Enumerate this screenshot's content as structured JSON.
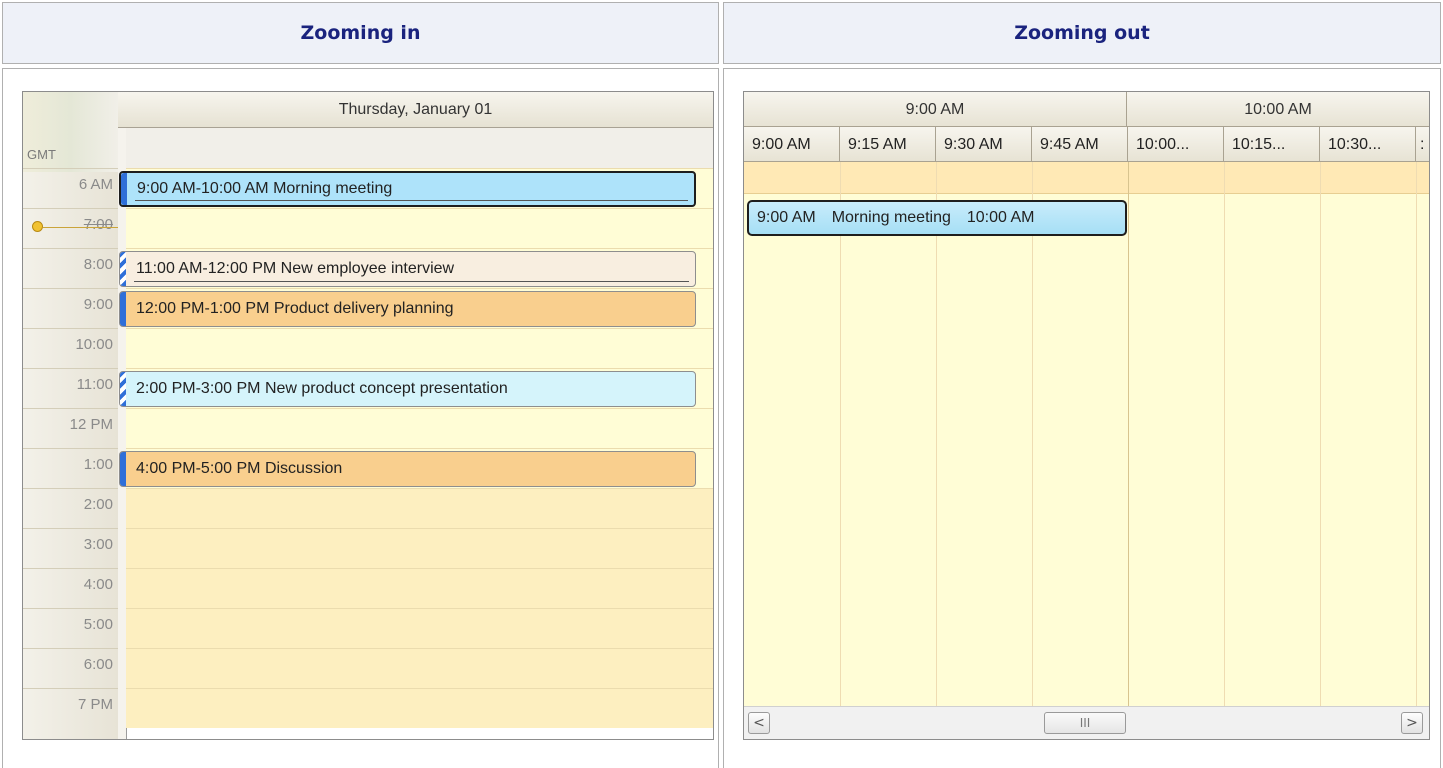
{
  "columns": [
    {
      "title": "Zooming in"
    },
    {
      "title": "Zooming out"
    }
  ],
  "day_view": {
    "date_header": "Thursday, January 01",
    "timezone_label": "GMT",
    "time_labels": [
      "6 AM",
      "7:00",
      "8:00",
      "9:00",
      "10:00",
      "11:00",
      "12 PM",
      "1:00",
      "2:00",
      "3:00",
      "4:00",
      "5:00",
      "6:00",
      "7 PM"
    ],
    "appointments": [
      {
        "text": "9:00 AM-10:00 AM Morning meeting",
        "selected": true,
        "status_color": "#2f6fd8",
        "bg": "#aee3fa",
        "status_pattern": "solid"
      },
      {
        "text": "11:00 AM-12:00 PM New employee interview",
        "selected": false,
        "status_color": "#2f6fd8",
        "bg": "#f8eee0",
        "status_pattern": "tentative"
      },
      {
        "text": "12:00 PM-1:00 PM Product delivery planning",
        "selected": false,
        "status_color": "#2f6fd8",
        "bg": "#f9cf8e",
        "status_pattern": "solid"
      },
      {
        "text": "2:00 PM-3:00 PM New product concept presentation",
        "selected": false,
        "status_color": "#2f6fd8",
        "bg": "#d5f4fb",
        "status_pattern": "tentative"
      },
      {
        "text": "4:00 PM-5:00 PM Discussion",
        "selected": false,
        "status_color": "#2f6fd8",
        "bg": "#f9cf8e",
        "status_pattern": "solid"
      }
    ]
  },
  "timeline_view": {
    "hour_headers": [
      "9:00 AM",
      "10:00 AM"
    ],
    "slot_headers": [
      "9:00 AM",
      "9:15 AM",
      "9:30 AM",
      "9:45 AM",
      "10:00...",
      "10:15...",
      "10:30...",
      ":"
    ],
    "appointment": {
      "start": "9:00 AM",
      "subject": "Morning meeting",
      "end": "10:00 AM"
    },
    "scrollbar": {
      "left_arrow": "<",
      "thumb": "III",
      "right_arrow": ">"
    }
  },
  "colors": {
    "header_title": "#1a237e",
    "work_area": "#fffdd6",
    "nonwork_area": "#fdefc0"
  }
}
